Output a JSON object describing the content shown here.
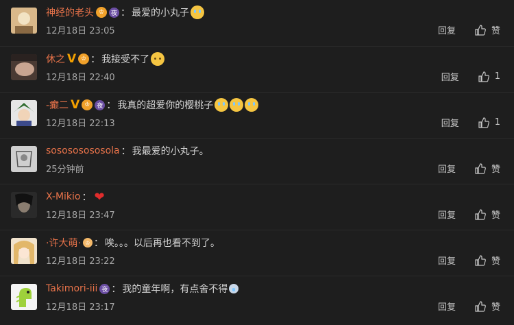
{
  "comments": [
    {
      "user": "神经的老头",
      "text": "最爱的小丸子",
      "time": "12月18日 23:05",
      "reply": "回复",
      "like": "赞",
      "badges": [
        "vip",
        "night"
      ],
      "emoji": "cry",
      "avatar": "#c9a36a"
    },
    {
      "user": "休之",
      "text": "我接受不了",
      "time": "12月18日 22:40",
      "reply": "回复",
      "like": "1",
      "badges": [
        "v",
        "vip"
      ],
      "emoji": "blank",
      "avatar": "#6d5a4a"
    },
    {
      "user": "-癫二",
      "text": "我真的超爱你的樱桃子",
      "time": "12月18日 22:13",
      "reply": "回复",
      "like": "1",
      "badges": [
        "v",
        "vip",
        "night"
      ],
      "emoji": "cry3",
      "avatar": "#3c6b3c"
    },
    {
      "user": "sosososososola",
      "text": "我最爱的小丸子。",
      "time": "25分钟前",
      "reply": "回复",
      "like": "赞",
      "badges": [],
      "emoji": "",
      "avatar": "#9a9a9a"
    },
    {
      "user": "X-Mikio",
      "text": "",
      "time": "12月18日 23:47",
      "reply": "回复",
      "like": "赞",
      "badges": [],
      "emoji": "heart",
      "avatar": "#3a3a3a"
    },
    {
      "user": "·许大萌·",
      "text": "唉。。。以后再也看不到了。",
      "time": "12月18日 23:22",
      "reply": "回复",
      "like": "赞",
      "badges": [
        "vipsmall"
      ],
      "emoji": "",
      "avatar": "#d8b38c"
    },
    {
      "user": "Takimori-iii",
      "text": "我的童年啊，有点舍不得",
      "time": "12月18日 23:17",
      "reply": "回复",
      "like": "赞",
      "badges": [
        "night"
      ],
      "emoji": "small",
      "avatar": "#e8e8e8"
    }
  ],
  "colors": {
    "username": "#e8734a",
    "background": "#1e1e1e",
    "v_badge": "#f3a000",
    "vip_badge": "#f1a12a",
    "night_badge": "#6b4ea3"
  },
  "badge_text": {
    "night": "夜",
    "vip": "♔",
    "v": "V"
  }
}
